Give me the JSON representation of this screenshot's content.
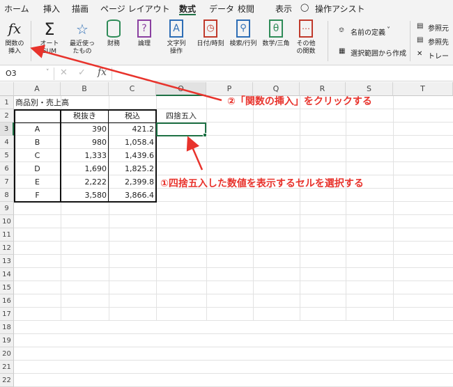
{
  "menu_tabs": [
    "ホーム",
    "挿入",
    "描画",
    "ページ レイアウト",
    "数式",
    "データ",
    "校閲",
    "表示",
    "操作アシスト"
  ],
  "ribbon": {
    "insert_function": "関数の\n挿入",
    "autosum": "オート\nSUM",
    "recent": "最近使っ\nたもの",
    "financial": "財務",
    "logical": "論理",
    "text": "文字列\n操作",
    "datetime": "日付/時刻",
    "lookup": "検索/行列",
    "math": "数学/三角",
    "more": "その他\nの関数",
    "define_name": "名前の定義",
    "create_from_selection": "選択範囲から作成",
    "trace_precedents": "参照元",
    "trace_dependents": "参照先",
    "remove_arrows": "トレー"
  },
  "formula_bar": {
    "namebox": "O3",
    "fx": "fx"
  },
  "columns": [
    "A",
    "B",
    "C",
    "O",
    "P",
    "Q",
    "R",
    "S",
    "T"
  ],
  "rows": [
    "1",
    "2",
    "3",
    "4",
    "5",
    "6",
    "7",
    "8",
    "9",
    "10",
    "11",
    "12",
    "13",
    "14",
    "15",
    "16",
    "17",
    "18",
    "19",
    "20",
    "21",
    "22"
  ],
  "sheet": {
    "title": "商品別・売上高",
    "header_tax_excl": "税抜き",
    "header_tax_incl": "税込",
    "header_rounded": "四捨五入",
    "data_rows": [
      {
        "name": "A",
        "excl": "390",
        "incl": "421.2"
      },
      {
        "name": "B",
        "excl": "980",
        "incl": "1,058.4"
      },
      {
        "name": "C",
        "excl": "1,333",
        "incl": "1,439.6"
      },
      {
        "name": "D",
        "excl": "1,690",
        "incl": "1,825.2"
      },
      {
        "name": "E",
        "excl": "2,222",
        "incl": "2,399.8"
      },
      {
        "name": "F",
        "excl": "3,580",
        "incl": "3,866.4"
      }
    ]
  },
  "annotations": {
    "step2": "②「関数の挿入」をクリックする",
    "step1": "①四捨五入した数値を表示するセルを選択する"
  },
  "colors": {
    "accent": "#1e7145",
    "annotation": "#e8332c"
  }
}
